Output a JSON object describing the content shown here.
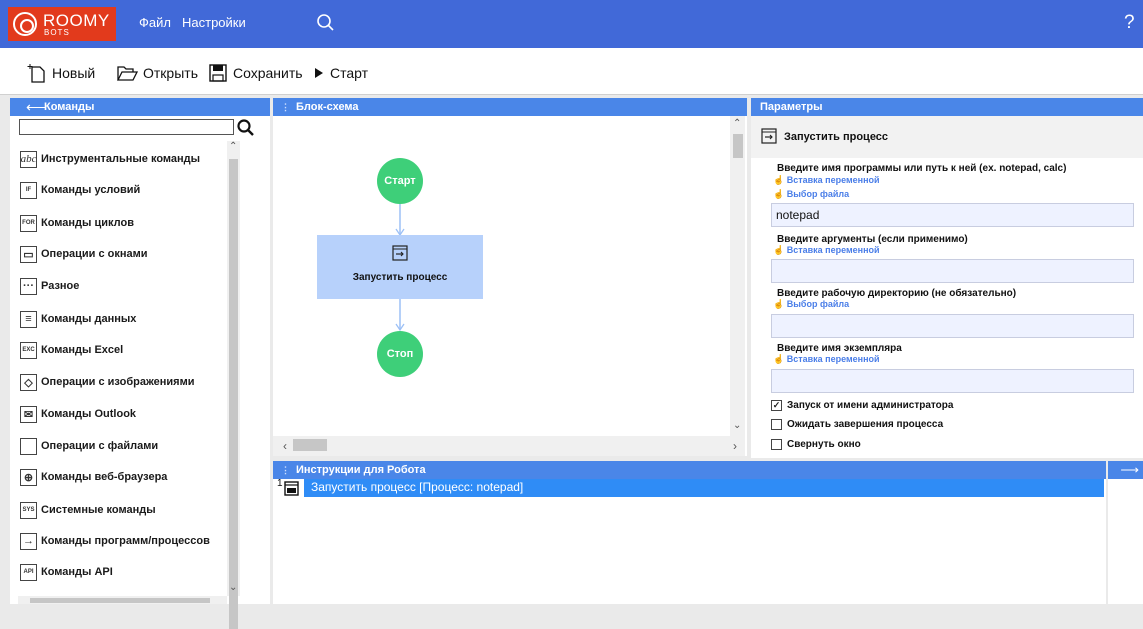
{
  "app": {
    "logo_text": "ROOMY",
    "logo_sub": "BOTS"
  },
  "menu": {
    "file": "Файл",
    "settings": "Настройки",
    "help": "?"
  },
  "toolbar": {
    "new": "Новый",
    "open": "Открыть",
    "save": "Сохранить",
    "start": "Старт"
  },
  "commands": {
    "title": "Команды",
    "search_value": "",
    "items": [
      {
        "label": "Инструментальные команды",
        "icon": "abc"
      },
      {
        "label": "Команды условий",
        "icon": "IF"
      },
      {
        "label": "Команды циклов",
        "icon": "FOR"
      },
      {
        "label": "Операции с окнами",
        "icon": "window"
      },
      {
        "label": "Разное",
        "icon": "..."
      },
      {
        "label": "Команды данных",
        "icon": "data"
      },
      {
        "label": "Команды Excel",
        "icon": "EXC"
      },
      {
        "label": "Операции с изображениями",
        "icon": "image"
      },
      {
        "label": "Команды Outlook",
        "icon": "mail"
      },
      {
        "label": "Операции с файлами",
        "icon": "file"
      },
      {
        "label": "Команды веб-браузера",
        "icon": "globe"
      },
      {
        "label": "Системные команды",
        "icon": "SYS"
      },
      {
        "label": "Команды программ/процессов",
        "icon": "process"
      },
      {
        "label": "Команды API",
        "icon": "API"
      }
    ]
  },
  "flow": {
    "title": "Блок-схема",
    "start": "Старт",
    "process": "Запустить процесс",
    "stop": "Стоп"
  },
  "params": {
    "title": "Параметры",
    "command": "Запустить процесс",
    "program_label": "Введите имя программы или путь к ней (ex. notepad, calc)",
    "insert_var": "Вставка переменной",
    "choose_file": "Выбор файла",
    "program_value": "notepad",
    "args_label": "Введите аргументы (если применимо)",
    "workdir_label": "Введите рабочую директорию (не обязательно)",
    "instance_label": "Введите имя экземпляра",
    "run_as_admin": "Запуск от имени администратора",
    "run_as_admin_checked": true,
    "wait_finish": "Ожидать завершения процесса",
    "minimize": "Свернуть окно"
  },
  "instructions": {
    "title": "Инструкции для Робота",
    "rows": [
      {
        "num": "1",
        "text": "Запустить процесс [Процесс: notepad]"
      }
    ]
  },
  "colors": {
    "topbar": "#4169d8",
    "header": "#4a86e8",
    "node": "#3ecf79",
    "process_node": "#b7d1fb",
    "selected_row": "#2f8cf6"
  }
}
